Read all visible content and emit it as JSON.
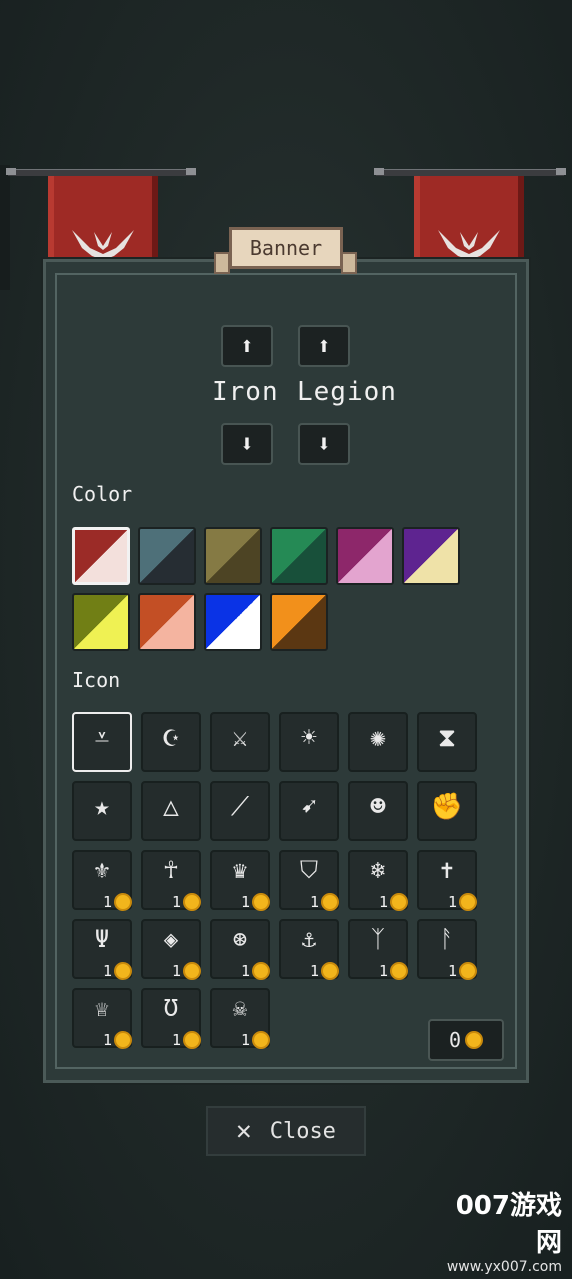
{
  "title": "Banner",
  "name": {
    "first": "Iron",
    "second": "Legion"
  },
  "color_section": {
    "label": "Color"
  },
  "colors": [
    {
      "a": "#9b2b27",
      "b": "#f3e0dc",
      "selected": true
    },
    {
      "a": "#4e7079",
      "b": "#262d33",
      "selected": false
    },
    {
      "a": "#857a44",
      "b": "#4d4424",
      "selected": false
    },
    {
      "a": "#258a55",
      "b": "#18503a",
      "selected": false
    },
    {
      "a": "#8d276a",
      "b": "#e3a4cf",
      "selected": false
    },
    {
      "a": "#5e2490",
      "b": "#efe2a8",
      "selected": false
    },
    {
      "a": "#717f15",
      "b": "#eff153",
      "selected": false
    },
    {
      "a": "#c34f25",
      "b": "#f4b4a0",
      "selected": false
    },
    {
      "a": "#0a33e6",
      "b": "#ffffff",
      "selected": false
    },
    {
      "a": "#f2901b",
      "b": "#5b3712",
      "selected": false
    }
  ],
  "icon_section": {
    "label": "Icon"
  },
  "icons": [
    {
      "name": "winged-emblem-icon",
      "glyph": "⩡",
      "cost": null,
      "selected": true
    },
    {
      "name": "crescent-star-icon",
      "glyph": "☪",
      "cost": null,
      "selected": false
    },
    {
      "name": "crossed-swords-icon",
      "glyph": "⚔",
      "cost": null,
      "selected": false
    },
    {
      "name": "sun-staff-icon",
      "glyph": "☀",
      "cost": null,
      "selected": false
    },
    {
      "name": "spider-icon",
      "glyph": "✺",
      "cost": null,
      "selected": false
    },
    {
      "name": "hourglass-icon",
      "glyph": "⧗",
      "cost": null,
      "selected": false
    },
    {
      "name": "star-icon",
      "glyph": "★",
      "cost": null,
      "selected": false
    },
    {
      "name": "hood-icon",
      "glyph": "△",
      "cost": null,
      "selected": false
    },
    {
      "name": "blade-icon",
      "glyph": "⟋",
      "cost": null,
      "selected": false
    },
    {
      "name": "bow-icon",
      "glyph": "➹",
      "cost": null,
      "selected": false
    },
    {
      "name": "discord-icon",
      "glyph": "☻",
      "cost": null,
      "selected": false
    },
    {
      "name": "fist-icon",
      "glyph": "✊",
      "cost": null,
      "selected": false
    },
    {
      "name": "fleur-de-lis-icon",
      "glyph": "⚜",
      "cost": "1",
      "selected": false
    },
    {
      "name": "ankh-icon",
      "glyph": "☥",
      "cost": "1",
      "selected": false
    },
    {
      "name": "crown-icon",
      "glyph": "♛",
      "cost": "1",
      "selected": false
    },
    {
      "name": "shield-icon",
      "glyph": "⛉",
      "cost": "1",
      "selected": false
    },
    {
      "name": "web-icon",
      "glyph": "❄",
      "cost": "1",
      "selected": false
    },
    {
      "name": "cross-icon",
      "glyph": "✝",
      "cost": "1",
      "selected": false
    },
    {
      "name": "trident-icon",
      "glyph": "Ψ",
      "cost": "1",
      "selected": false
    },
    {
      "name": "diamond-target-icon",
      "glyph": "◈",
      "cost": "1",
      "selected": false
    },
    {
      "name": "wheel-icon",
      "glyph": "⊛",
      "cost": "1",
      "selected": false
    },
    {
      "name": "anchor-icon",
      "glyph": "⚓",
      "cost": "1",
      "selected": false
    },
    {
      "name": "rune-y-icon",
      "glyph": "ᛉ",
      "cost": "1",
      "selected": false
    },
    {
      "name": "rune-branch-icon",
      "glyph": "ᚨ",
      "cost": "1",
      "selected": false
    },
    {
      "name": "claw-crown-icon",
      "glyph": "♕",
      "cost": "1",
      "selected": false
    },
    {
      "name": "horseshoe-icon",
      "glyph": "Ʊ",
      "cost": "1",
      "selected": false
    },
    {
      "name": "skull-icon",
      "glyph": "☠",
      "cost": "1",
      "selected": false
    }
  ],
  "currency": {
    "amount": "0"
  },
  "close_button": {
    "label": "Close",
    "icon": "x-icon"
  },
  "watermark": {
    "big": "007游戏网",
    "small": "www.yx007.com"
  }
}
